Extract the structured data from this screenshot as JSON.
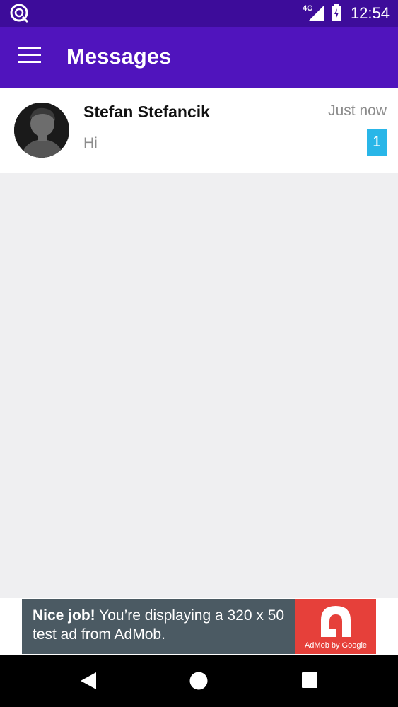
{
  "status_bar": {
    "network": "4G",
    "time": "12:54",
    "icons": [
      "app-notification-icon",
      "signal-icon",
      "battery-icon"
    ]
  },
  "app_bar": {
    "title": "Messages",
    "menu_icon": "hamburger-menu-icon",
    "color": "#5014bd"
  },
  "conversations": [
    {
      "name": "Stefan Stefancik",
      "snippet": "Hi",
      "time": "Just now",
      "unread": "1"
    }
  ],
  "ad": {
    "headline": "Nice job!",
    "body": "You’re displaying a 320 x 50 test ad from AdMob.",
    "brand": "AdMob by Google"
  },
  "nav_bar": {
    "icons": [
      "back-icon",
      "home-icon",
      "recents-icon"
    ]
  },
  "colors": {
    "status_bar": "#3d0c9a",
    "badge": "#29b6e8",
    "ad_logo": "#e6403a"
  }
}
